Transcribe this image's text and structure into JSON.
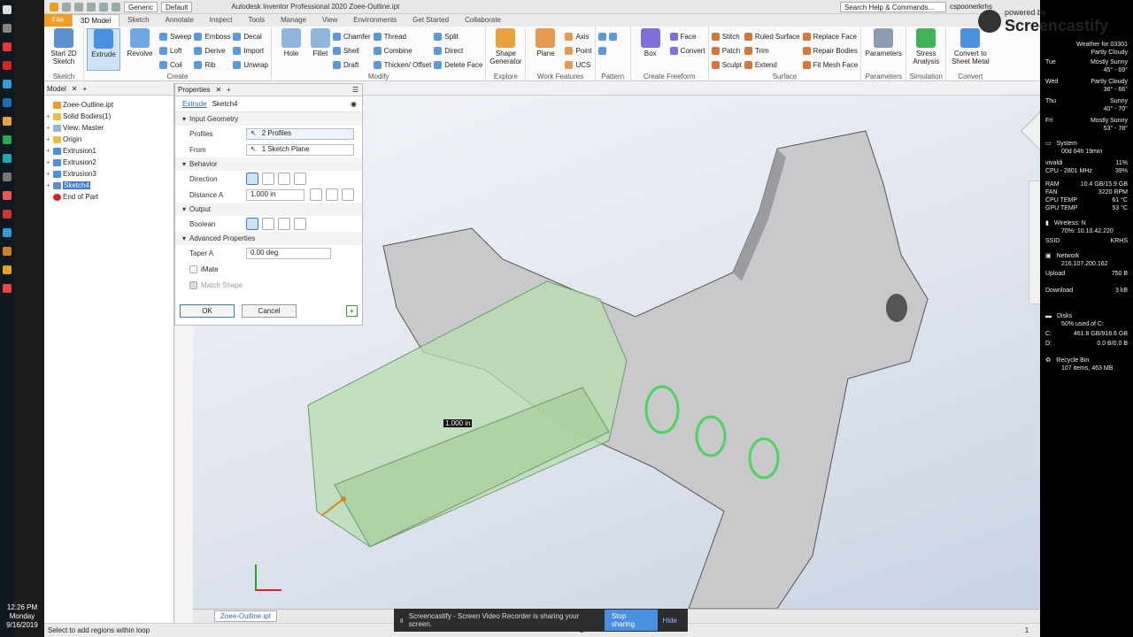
{
  "taskbar": {
    "time": "12:26 PM",
    "day": "Monday",
    "date": "9/16/2019"
  },
  "qat": {
    "appearance": "Generic",
    "material": "Default",
    "title": "Autodesk Inventor Professional 2020   Zoee-Outline.ipt",
    "search": "Search Help & Commands...",
    "user": "cspoonerkrhs"
  },
  "tabs": [
    "File",
    "3D Model",
    "Sketch",
    "Annotate",
    "Inspect",
    "Tools",
    "Manage",
    "View",
    "Environments",
    "Get Started",
    "Collaborate"
  ],
  "ribbon": {
    "sketch": {
      "label": "Sketch",
      "start": "Start 2D Sketch"
    },
    "create": {
      "label": "Create",
      "extrude": "Extrude",
      "revolve": "Revolve",
      "sweep": "Sweep",
      "loft": "Loft",
      "coil": "Coil",
      "emboss": "Emboss",
      "derive": "Derive",
      "rib": "Rib",
      "decal": "Decal",
      "import": "Import",
      "unwrap": "Unwrap"
    },
    "modify": {
      "label": "Modify",
      "hole": "Hole",
      "fillet": "Fillet",
      "chamfer": "Chamfer",
      "shell": "Shell",
      "draft": "Draft",
      "thread": "Thread",
      "combine": "Combine",
      "thicken": "Thicken/ Offset",
      "split": "Split",
      "direct": "Direct",
      "delete": "Delete Face"
    },
    "explore": {
      "label": "Explore",
      "shape": "Shape Generator"
    },
    "work": {
      "label": "Work Features",
      "plane": "Plane",
      "axis": "Axis",
      "point": "Point",
      "ucs": "UCS"
    },
    "pattern": {
      "label": "Pattern"
    },
    "freeform": {
      "label": "Create Freeform",
      "box": "Box",
      "face": "Face",
      "convert": "Convert"
    },
    "surface": {
      "label": "Surface",
      "stitch": "Stitch",
      "patch": "Patch",
      "sculpt": "Sculpt",
      "ruled": "Ruled Surface",
      "trim": "Trim",
      "extend": "Extend",
      "replace": "Replace Face",
      "repair": "Repair Bodies",
      "fitmesh": "Fit Mesh Face"
    },
    "params": {
      "label": "Parameters",
      "btn": "Parameters"
    },
    "sim": {
      "label": "Simulation",
      "btn": "Stress Analysis"
    },
    "conv": {
      "label": "Convert",
      "btn": "Convert to Sheet Metal"
    }
  },
  "browser": {
    "tab": "Model",
    "nodes": [
      "Zoee-Outline.ipt",
      "Solid Bodies(1)",
      "View: Master",
      "Origin",
      "Extrusion1",
      "Extrusion2",
      "Extrusion3",
      "Sketch4",
      "End of Part"
    ]
  },
  "props": {
    "tab": "Properties",
    "crumb_link": "Extrude",
    "crumb": "Sketch4",
    "input_geom": "Input Geometry",
    "profiles_lbl": "Profiles",
    "profiles": "2 Profiles",
    "from_lbl": "From",
    "from": "1 Sketch Plane",
    "behavior": "Behavior",
    "direction_lbl": "Direction",
    "distance_lbl": "Distance A",
    "distance": "1.000 in",
    "output": "Output",
    "boolean_lbl": "Boolean",
    "advanced": "Advanced Properties",
    "taper_lbl": "Taper A",
    "taper": "0.00 deg",
    "imate": "iMate",
    "match": "Match Shape",
    "ok": "OK",
    "cancel": "Cancel"
  },
  "viewport": {
    "dim_label": "1.000 in"
  },
  "doc_tab": "Zoee-Outline.ipt",
  "status": {
    "hint": "Select to add regions within loop",
    "n1": "1",
    "n2": "1"
  },
  "share": {
    "text": "Screencastify - Screen Video Recorder is sharing your screen.",
    "stop": "Stop sharing",
    "hide": "Hide"
  },
  "screencastify": {
    "powered": "powered by",
    "brand": "Screencastify"
  },
  "weather": {
    "title": "Weather for 03301",
    "now": "Partly Cloudy",
    "days": [
      {
        "d": "Tue",
        "c": "Mostly Sunny",
        "t": "45° - 69°"
      },
      {
        "d": "Wed",
        "c": "Partly Cloudy",
        "t": "36° - 66°"
      },
      {
        "d": "Thu",
        "c": "Sunny",
        "t": "40° - 70°"
      },
      {
        "d": "Fri",
        "c": "Mostly Sunny",
        "t": "53° - 78°"
      }
    ]
  },
  "system": {
    "title": "System",
    "uptime": "00d 04h 19min",
    "rows": [
      [
        "vivaldi",
        "11%"
      ],
      [
        "CPU - 2801 MHz",
        "39%"
      ],
      [
        "RAM",
        "10.4 GB/15.9 GB"
      ],
      [
        "FAN",
        "3220 RPM"
      ],
      [
        "CPU TEMP",
        "61 °C"
      ],
      [
        "GPU TEMP",
        "53 °C"
      ]
    ]
  },
  "wireless": {
    "title": "Wireless: N",
    "info": "70%: 10.10.42.220",
    "ssid_lbl": "SSID",
    "ssid": "KRHS"
  },
  "network": {
    "title": "Network",
    "ip": "216.107.200.162",
    "upload_lbl": "Upload",
    "upload": "750 B",
    "download_lbl": "Download",
    "download": "3 kB"
  },
  "disks": {
    "title": "Disks",
    "info": "50% used of C:",
    "c_lbl": "C:",
    "c": "461.8 GB/918.6 GB",
    "d_lbl": "D:",
    "d": "0.0 B/0.0 B"
  },
  "recycle": {
    "title": "Recycle Bin",
    "info": "107  items, 463 MB"
  }
}
